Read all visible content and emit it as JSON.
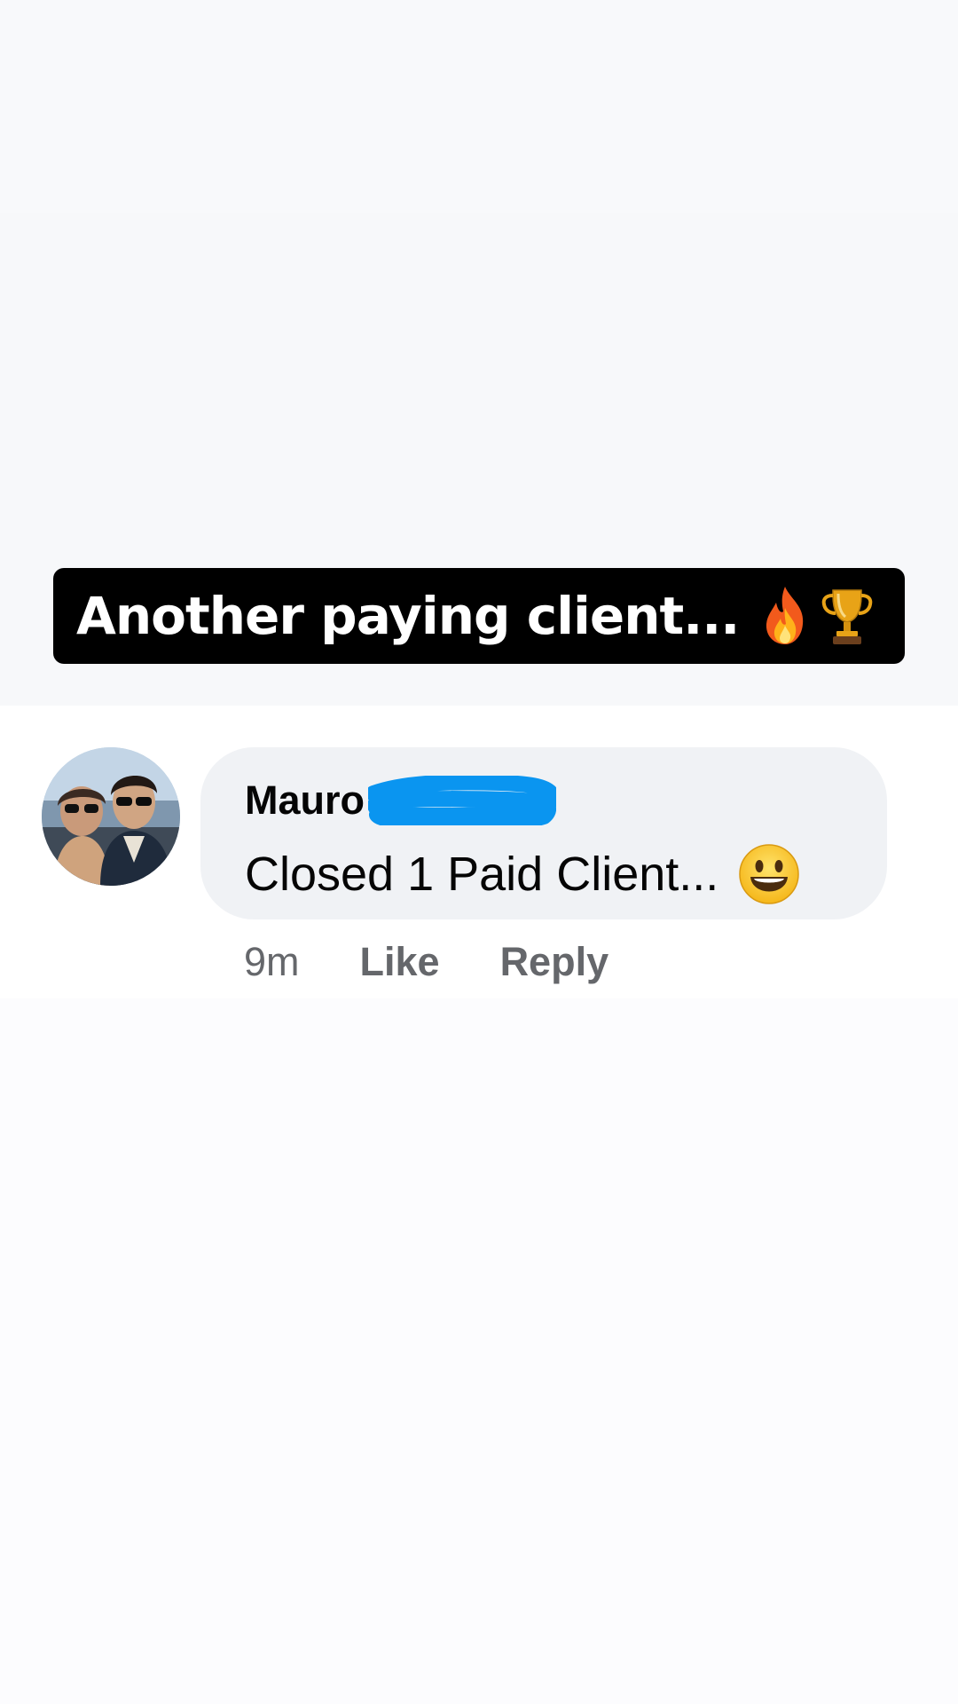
{
  "caption": {
    "text": "Another paying client...",
    "icons": [
      "fire-icon",
      "trophy-icon"
    ]
  },
  "comment": {
    "author": "Mauro",
    "author_surname_redacted": true,
    "redaction_color": "#0a95f0",
    "text": "Closed 1 Paid Client...",
    "text_emoji": "smiley-icon",
    "bubble_color": "#f0f2f5",
    "avatar": "avatar-photo"
  },
  "actions": {
    "timestamp": "9m",
    "like_label": "Like",
    "reply_label": "Reply",
    "color": "#65676b"
  }
}
